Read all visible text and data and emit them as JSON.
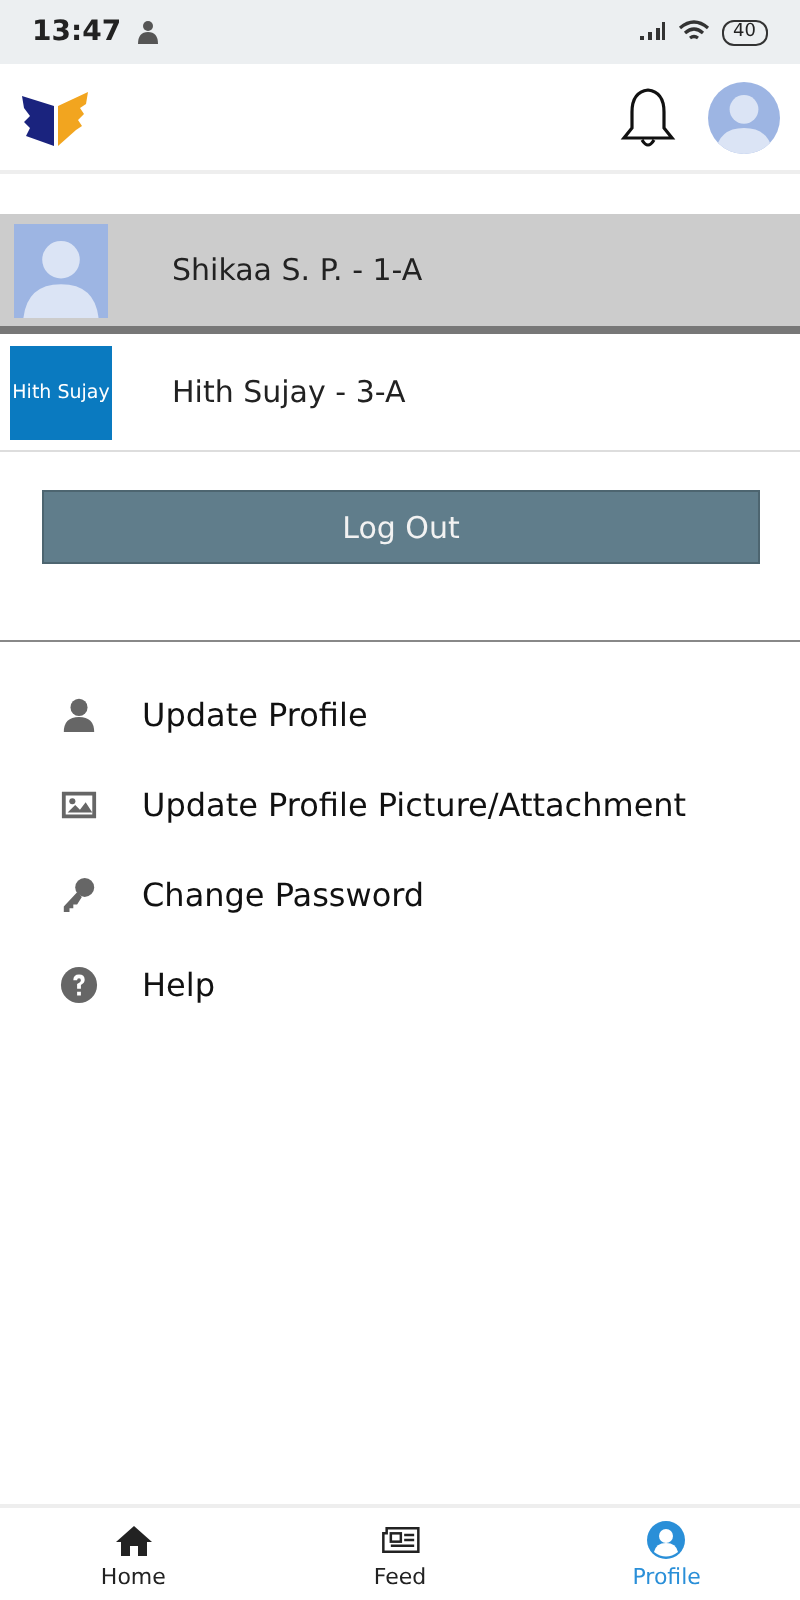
{
  "status_bar": {
    "time": "13:47",
    "battery": "40"
  },
  "students": [
    {
      "name": "Shikaa S. P. - 1-A",
      "selected": true,
      "avatar": {
        "kind": "silhouette"
      }
    },
    {
      "name": "Hith Sujay - 3-A",
      "selected": false,
      "avatar": {
        "kind": "text",
        "text": "Hith Sujay"
      }
    }
  ],
  "logout_button": "Log Out",
  "menu": [
    {
      "kind": "person",
      "label": "Update Profile"
    },
    {
      "kind": "image",
      "label": "Update Profile Picture/Attachment"
    },
    {
      "kind": "key",
      "label": "Change Password"
    },
    {
      "kind": "help",
      "label": "Help"
    }
  ],
  "bottom_nav": [
    {
      "kind": "home",
      "label": "Home",
      "selected": false
    },
    {
      "kind": "feed",
      "label": "Feed",
      "selected": false
    },
    {
      "kind": "profile",
      "label": "Profile",
      "selected": true
    }
  ]
}
